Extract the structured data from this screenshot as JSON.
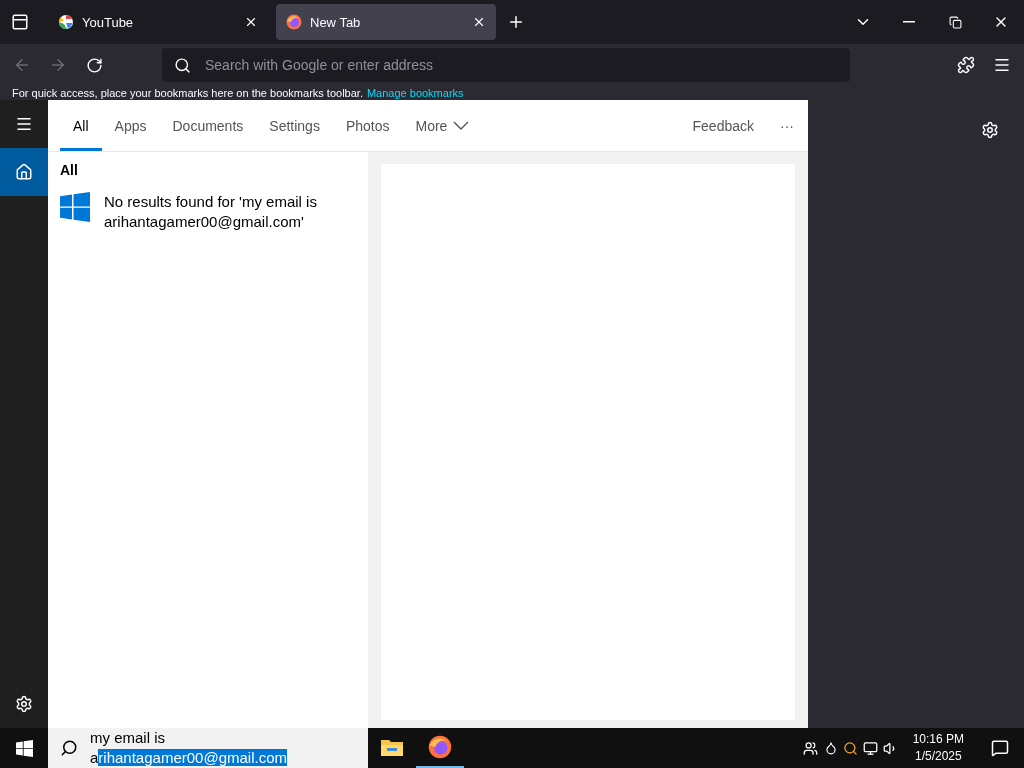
{
  "browser": {
    "tabs": [
      {
        "title": "YouTube",
        "kind": "google",
        "selected": false
      },
      {
        "title": "New Tab",
        "kind": "firefox",
        "selected": true
      }
    ],
    "address_placeholder": "Search with Google or enter address",
    "bookmarks_hint": "For quick access, place your bookmarks here on the bookmarks toolbar.",
    "bookmarks_link": "Manage bookmarks"
  },
  "search": {
    "tabs": [
      {
        "label": "All",
        "selected": true,
        "kind": "plain"
      },
      {
        "label": "Apps",
        "selected": false,
        "kind": "plain"
      },
      {
        "label": "Documents",
        "selected": false,
        "kind": "plain"
      },
      {
        "label": "Settings",
        "selected": false,
        "kind": "plain"
      },
      {
        "label": "Photos",
        "selected": false,
        "kind": "plain"
      },
      {
        "label": "More",
        "selected": false,
        "kind": "dropdown"
      }
    ],
    "feedback": "Feedback",
    "more_options": "···",
    "section": "All",
    "result": "No results found for 'my email is arihantagamer00@gmail.com'",
    "query_before": "my email is a",
    "query_selected": "rihantagamer00@gmail.com"
  },
  "taskbar": {
    "apps": [
      {
        "kind": "explorer",
        "active": false
      },
      {
        "kind": "firefox",
        "active": true
      }
    ],
    "time": "10:16 PM",
    "date": "1/5/2025"
  }
}
